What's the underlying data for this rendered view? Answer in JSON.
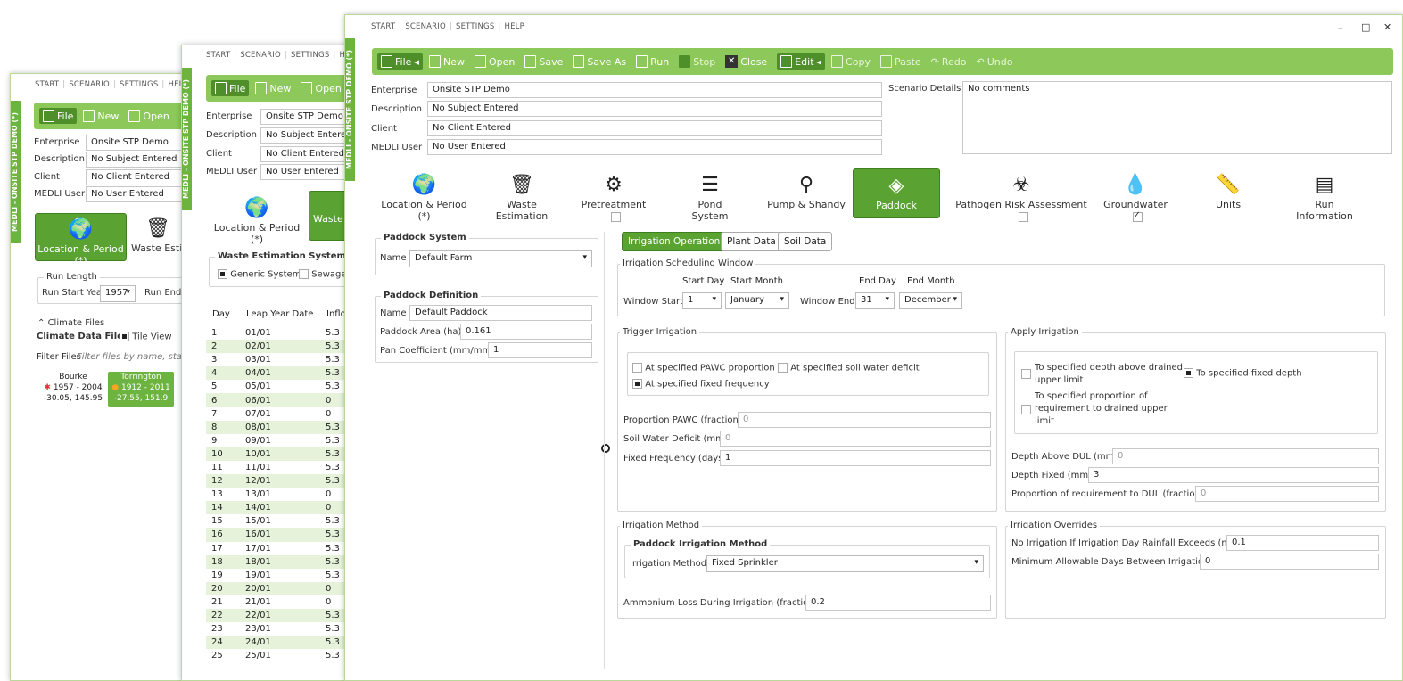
{
  "common": {
    "vtab": "MEDLI - ONSITE STP DEMO (*)",
    "nav": [
      "START",
      "SCENARIO",
      "SETTINGS",
      "HELP"
    ],
    "labels": {
      "enterprise": "Enterprise",
      "description": "Description",
      "client": "Client",
      "medli_user": "MEDLI User"
    },
    "values": {
      "enterprise": "Onsite STP Demo",
      "description": "No Subject Entered",
      "client": "No Client Entered",
      "medli_user": "No User Entered"
    }
  },
  "toolbar": {
    "file": "File",
    "new": "New",
    "open": "Open",
    "save": "Save",
    "save_as": "Save As",
    "run": "Run",
    "stop": "Stop",
    "close": "Close",
    "edit": "Edit",
    "copy": "Copy",
    "paste": "Paste",
    "redo": "Redo",
    "undo": "Undo"
  },
  "win1": {
    "nav_location": "Location & Period (*)",
    "nav_waste": "Waste Estim",
    "run_length": "Run Length",
    "run_start_label": "Run Start Year",
    "run_start_value": "1957",
    "run_end_label": "Run End Y",
    "climate_files": "Climate Files",
    "climate_data_files": "Climate Data Files",
    "tile_view": "Tile View",
    "filter_label": "Filter Files",
    "filter_placeholder": "Filter files by name, start year",
    "stations": [
      {
        "name": "Bourke",
        "years": "1957 - 2004",
        "coords": "-30.05, 145.95"
      },
      {
        "name": "Torrington",
        "years": "1912 - 2011",
        "coords": "-27.55, 151.9"
      }
    ]
  },
  "win2": {
    "nav_location": "Location & Period (*)",
    "nav_waste": "Waste E",
    "system_type": "Waste Estimation System Type",
    "generic": "Generic System",
    "sewage": "Sewage",
    "headers": [
      "Day",
      "Leap Year Date",
      "Inflo"
    ],
    "rows": [
      [
        "1",
        "01/01",
        "5.3"
      ],
      [
        "2",
        "02/01",
        "5.3"
      ],
      [
        "3",
        "03/01",
        "5.3"
      ],
      [
        "4",
        "04/01",
        "5.3"
      ],
      [
        "5",
        "05/01",
        "5.3"
      ],
      [
        "6",
        "06/01",
        "0"
      ],
      [
        "7",
        "07/01",
        "0"
      ],
      [
        "8",
        "08/01",
        "5.3"
      ],
      [
        "9",
        "09/01",
        "5.3"
      ],
      [
        "10",
        "10/01",
        "5.3"
      ],
      [
        "11",
        "11/01",
        "5.3"
      ],
      [
        "12",
        "12/01",
        "5.3"
      ],
      [
        "13",
        "13/01",
        "0"
      ],
      [
        "14",
        "14/01",
        "0"
      ],
      [
        "15",
        "15/01",
        "5.3"
      ],
      [
        "16",
        "16/01",
        "5.3"
      ],
      [
        "17",
        "17/01",
        "5.3"
      ],
      [
        "18",
        "18/01",
        "5.3"
      ],
      [
        "19",
        "19/01",
        "5.3"
      ],
      [
        "20",
        "20/01",
        "0"
      ],
      [
        "21",
        "21/01",
        "0"
      ],
      [
        "22",
        "22/01",
        "5.3"
      ],
      [
        "23",
        "23/01",
        "5.3"
      ],
      [
        "24",
        "24/01",
        "5.3"
      ],
      [
        "25",
        "25/01",
        "5.3"
      ]
    ]
  },
  "win3": {
    "scenario_details_label": "Scenario Details",
    "scenario_details_value": "No comments",
    "nav": [
      {
        "label": "Location & Period (*)",
        "icon": "globe-icon",
        "glyph": "🌍"
      },
      {
        "label": "Waste Estimation",
        "icon": "bin-icon",
        "glyph": "🗑"
      },
      {
        "label": "Pretreatment",
        "icon": "pretreatment-icon",
        "glyph": "⚙"
      },
      {
        "label": "Pond System",
        "icon": "pond-icon",
        "glyph": "☰"
      },
      {
        "label": "Pump & Shandy",
        "icon": "pump-icon",
        "glyph": "⚲"
      },
      {
        "label": "Paddock",
        "icon": "layers-icon",
        "glyph": "◈"
      },
      {
        "label": "Pathogen Risk Assessment",
        "icon": "biohazard-icon",
        "glyph": "☣"
      },
      {
        "label": "Groundwater",
        "icon": "drop-icon",
        "glyph": "💧"
      },
      {
        "label": "Units",
        "icon": "ruler-icon",
        "glyph": "📏"
      },
      {
        "label": "Run Information",
        "icon": "info-icon",
        "glyph": "▤"
      }
    ],
    "paddock_system": "Paddock System",
    "name_label": "Name",
    "farm_value": "Default Farm",
    "paddock_definition": "Paddock Definition",
    "paddock_name_value": "Default Paddock",
    "area_label": "Paddock Area (ha)",
    "area_value": "0.161",
    "pan_label": "Pan Coefficient (mm/mm)",
    "pan_value": "1",
    "subtabs": [
      "Irrigation Operation",
      "Plant Data",
      "Soil Data"
    ],
    "sched_window": "Irrigation Scheduling Window",
    "start_day": "Start Day",
    "start_month": "Start Month",
    "end_day": "End Day",
    "end_month": "End Month",
    "window_start": "Window Start",
    "window_start_day": "1",
    "window_start_month": "January",
    "window_end": "Window End",
    "window_end_day": "31",
    "window_end_month": "December",
    "trigger": "Trigger Irrigation",
    "trig_pawc": "At specified PAWC proportion",
    "trig_deficit": "At specified soil water deficit",
    "trig_freq": "At specified fixed frequency",
    "prop_pawc_label": "Proportion PAWC (fraction)",
    "prop_pawc_value": "0",
    "swd_label": "Soil Water Deficit (mm)",
    "swd_value": "0",
    "freq_label": "Fixed Frequency (days)",
    "freq_value": "1",
    "apply": "Apply Irrigation",
    "apply_depth_dul_1": "To specified depth above drained",
    "apply_depth_dul_2": "upper limit",
    "apply_fixed": "To specified fixed depth",
    "apply_prop_1": "To specified proportion of",
    "apply_prop_2": "requirement to drained upper",
    "apply_prop_3": "limit",
    "depth_dul_label": "Depth Above DUL (mm)",
    "depth_dul_value": "0",
    "depth_fixed_label": "Depth Fixed (mm)",
    "depth_fixed_value": "3",
    "prop_req_label": "Proportion of requirement to DUL (fraction)",
    "prop_req_value": "0",
    "method": "Irrigation Method",
    "paddock_method": "Paddock Irrigation Method",
    "method_label": "Irrigation Method",
    "method_value": "Fixed Sprinkler",
    "ammonium_label": "Ammonium Loss During Irrigation (fraction)",
    "ammonium_value": "0.2",
    "overrides": "Irrigation Overrides",
    "rain_label": "No Irrigation If Irrigation Day Rainfall Exceeds (mm)",
    "rain_value": "0.1",
    "min_days_label": "Minimum Allowable Days Between Irrigations",
    "min_days_value": "0"
  },
  "colors": {
    "accent": "#8cc85a",
    "active": "#5aa332",
    "dark": "#4e8f2a"
  }
}
